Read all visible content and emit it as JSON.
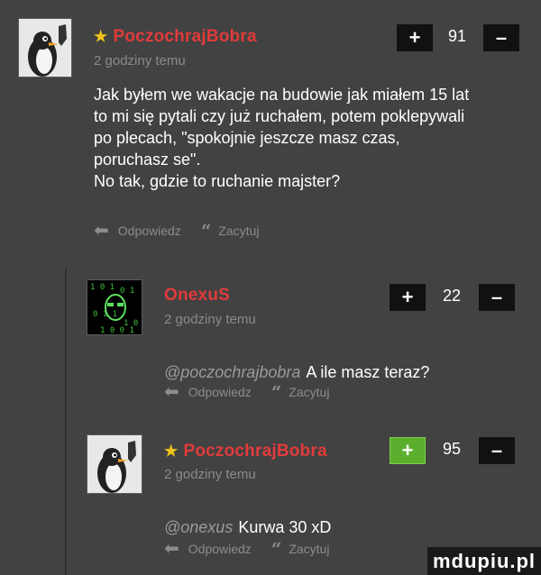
{
  "comments": [
    {
      "author": "PoczochrajBobra",
      "starred": true,
      "time": "2 godziny temu",
      "text": "Jak byłem we wakacje na budowie jak miałem 15 lat\nto mi się pytali czy już ruchałem, potem poklepywali\npo plecach, \"spokojnie jeszcze masz czas,\nporuchasz se\".\nNo tak, gdzie to ruchanie majster?",
      "score": "91",
      "upvoted": false
    },
    {
      "author": "OnexuS",
      "starred": false,
      "time": "2 godziny temu",
      "mention": "@poczochrajbobra",
      "text": "A ile masz teraz?",
      "score": "22",
      "upvoted": false
    },
    {
      "author": "PoczochrajBobra",
      "starred": true,
      "time": "2 godziny temu",
      "mention": "@onexus",
      "text": "Kurwa 30 xD",
      "score": "95",
      "upvoted": true
    }
  ],
  "labels": {
    "reply": "Odpowiedz",
    "quote": "Zacytuj",
    "plus": "+",
    "minus": "–",
    "star": "★"
  },
  "icons": {
    "reply": "reply-arrow-icon",
    "quote": "quote-icon"
  },
  "colors": {
    "background": "#424242",
    "author": "#e23b3b",
    "star": "#f0c419",
    "upvote_active": "#5cae2e",
    "vote_button": "#111111"
  },
  "watermark": "mdupiu.pl"
}
